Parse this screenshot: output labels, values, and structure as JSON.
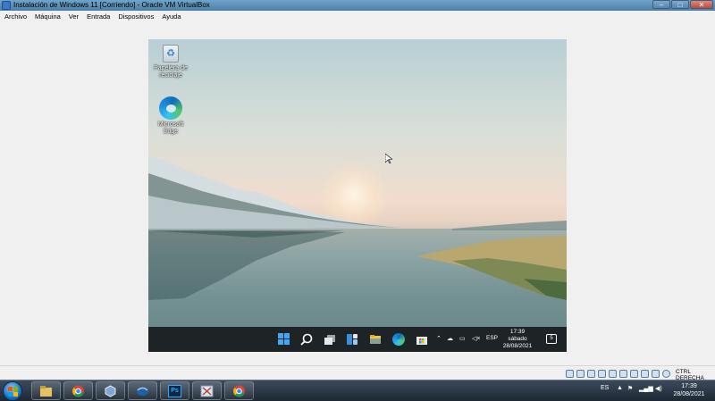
{
  "window": {
    "title": "Instalación de Windows 11 [Corriendo] - Oracle VM VirtualBox",
    "controls": [
      "–",
      "□",
      "✕"
    ]
  },
  "menu": [
    "Archivo",
    "Máquina",
    "Ver",
    "Entrada",
    "Dispositivos",
    "Ayuda"
  ],
  "guest": {
    "desktop_icons": [
      {
        "label": "Papelera de reciclaje",
        "icon": "recycle-bin-icon"
      },
      {
        "label": "Microsoft Edge",
        "icon": "edge-icon"
      }
    ],
    "taskbar": {
      "apps": [
        "start-icon",
        "search-icon",
        "task-view-icon",
        "widgets-icon",
        "file-explorer-icon",
        "edge-icon",
        "store-icon"
      ],
      "tray_language": "ESP",
      "clock_time": "17:39",
      "clock_day": "sábado",
      "clock_date": "28/08/2021",
      "notifications": "5"
    }
  },
  "vbox_status": {
    "host_key": "CTRL DERECHA"
  },
  "host_taskbar": {
    "apps": [
      "windows-explorer-icon",
      "chrome-icon",
      "virtualbox-icon",
      "thunderbird-icon",
      "photoshop-icon",
      "snipping-tool-icon",
      "chrome-icon"
    ],
    "photoshop_label": "Ps",
    "language": "ES",
    "clock_time": "17:39",
    "clock_date": "28/08/2021"
  },
  "colors": {
    "accent": "#3fa9f5",
    "host_taskbar": "#1d2833",
    "guest_taskbar": "#1e2326"
  }
}
